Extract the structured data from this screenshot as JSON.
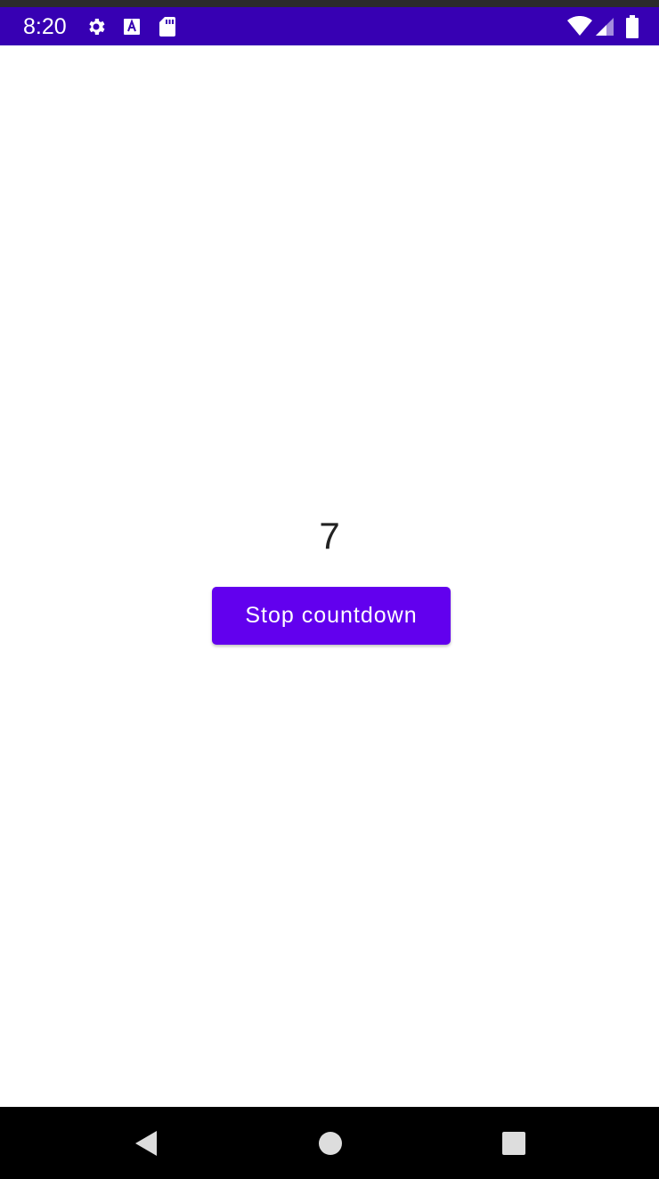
{
  "status_bar": {
    "time": "8:20",
    "icons": [
      "gear-icon",
      "a-badge-icon",
      "sd-card-icon",
      "wifi-icon",
      "cell-signal-icon",
      "battery-icon"
    ],
    "color": "#3700b3"
  },
  "main": {
    "counter_value": "7",
    "stop_button_label": "Stop countdown",
    "button_color": "#6200ee"
  },
  "nav_bar": {
    "buttons": [
      "back-icon",
      "home-icon",
      "recents-icon"
    ]
  }
}
